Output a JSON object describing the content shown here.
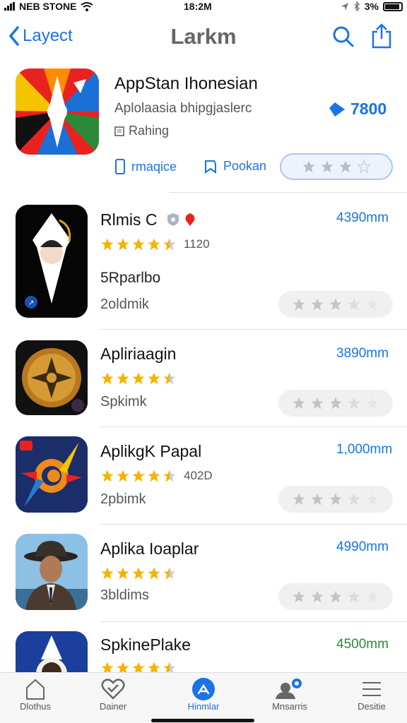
{
  "status": {
    "carrier": "NEB STONE",
    "time": "18:2M",
    "battery": "3%"
  },
  "nav": {
    "back_label": "Layect",
    "title": "Larkm"
  },
  "featured": {
    "title": "AppStan Ihonesian",
    "subtitle": "Aplolaasia bhipgjaslerc",
    "rank_label": "Rahing",
    "price": "7800",
    "action1_label": "rmaqice",
    "action2_label": "Pookan"
  },
  "apps": [
    {
      "title": "Rlmis C",
      "rating_count": "1120",
      "subtitle1": "5Rparlbo",
      "subtitle2": "2oldmik",
      "price": "4390mm",
      "stars": 4.5
    },
    {
      "title": "Apliriaagin",
      "rating_count": "",
      "subtitle1": "",
      "subtitle2": "Spkimk",
      "price": "3890mm",
      "stars": 4.5
    },
    {
      "title": "AplikgK Papal",
      "rating_count": "402D",
      "subtitle1": "",
      "subtitle2": "2pbimk",
      "price": "1,000mm",
      "stars": 4.5
    },
    {
      "title": "Aplika Ioaplar",
      "rating_count": "",
      "subtitle1": "",
      "subtitle2": "3bldims",
      "price": "4990mm",
      "stars": 4.5
    },
    {
      "title": "SpkinePlake",
      "rating_count": "",
      "subtitle1": "",
      "subtitle2": "",
      "price": "4500mm",
      "stars": 4.5
    }
  ],
  "tabs": [
    {
      "label": "Dlothus",
      "icon": "home-icon"
    },
    {
      "label": "Dainer",
      "icon": "heart-check-icon"
    },
    {
      "label": "Hinmlar",
      "icon": "apps-icon"
    },
    {
      "label": "Mnsarris",
      "icon": "users-icon"
    },
    {
      "label": "Desitie",
      "icon": "menu-icon"
    }
  ],
  "colors": {
    "accent": "#1a73e8",
    "star": "#f5b400",
    "green_price": "#2a8a3a"
  }
}
